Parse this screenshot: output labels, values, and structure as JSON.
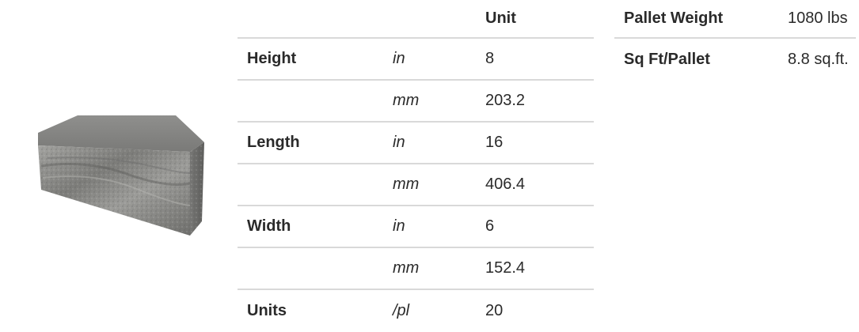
{
  "spec_table": {
    "header": {
      "label": "",
      "unit": "",
      "value": "Unit"
    },
    "rows": [
      {
        "label": "Height",
        "unit": "in",
        "value": "8"
      },
      {
        "label": "",
        "unit": "mm",
        "value": "203.2"
      },
      {
        "label": "Length",
        "unit": "in",
        "value": "16"
      },
      {
        "label": "",
        "unit": "mm",
        "value": "406.4"
      },
      {
        "label": "Width",
        "unit": "in",
        "value": "6"
      },
      {
        "label": "",
        "unit": "mm",
        "value": "152.4"
      },
      {
        "label": "Units",
        "unit": "/pl",
        "value": "20"
      }
    ]
  },
  "pallet_table": {
    "rows": [
      {
        "label": "Pallet Weight",
        "value": "1080 lbs"
      },
      {
        "label": "Sq Ft/Pallet",
        "value": "8.8 sq.ft."
      }
    ]
  },
  "colors": {
    "divider": "#d9d9d9",
    "text": "#2a2a2a",
    "stone_light": "#9a9a98",
    "stone_dark": "#5c5c5a"
  }
}
